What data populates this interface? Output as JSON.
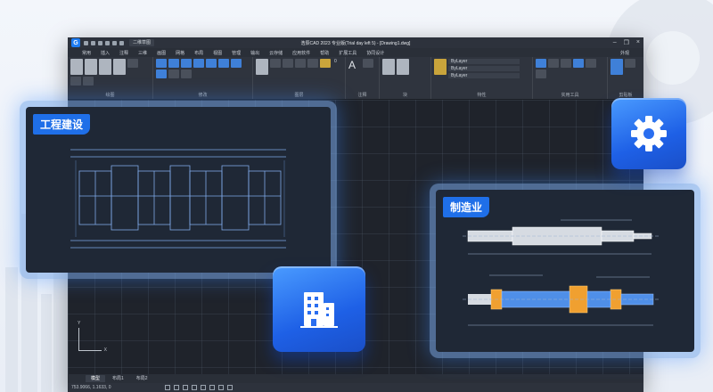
{
  "app": {
    "window_title": "浩辰CAD 2023 专业版(Trial day left 5) - [Drawing1.dwg]",
    "workspace": "二维草图",
    "right_label": "外观"
  },
  "menu": [
    "常用",
    "插入",
    "注释",
    "三维",
    "画图",
    "网格",
    "布局",
    "视图",
    "管理",
    "输出",
    "云存储",
    "应用软件",
    "帮助",
    "扩展工具",
    "协同设计"
  ],
  "ribbon": {
    "draw_tools": [
      "直线",
      "多段线",
      "圆",
      "圆弧"
    ],
    "modify_tools": [
      "移动",
      "复制",
      "拉伸",
      "旋转",
      "镜像",
      "分解",
      "修剪",
      "偏移"
    ],
    "layer_tools": [
      "图层特性"
    ],
    "text_tools": [
      "文字"
    ],
    "insert_tools": [
      "插入",
      "二维码"
    ],
    "property_tools": [
      "特性匹配"
    ],
    "bylayer_values": [
      "ByLayer",
      "ByLayer",
      "ByLayer"
    ],
    "layer_current": "0",
    "group_labels": [
      "绘图",
      "修改",
      "图层",
      "注释",
      "块",
      "特性",
      "实用工具",
      "剪贴板"
    ],
    "other_tools": [
      "组",
      "查询",
      "粘贴"
    ]
  },
  "tabs": [
    "模型",
    "布局1",
    "布局2"
  ],
  "status": {
    "coords": "753.9066, 1.1633, 0"
  },
  "cards": {
    "civil": "工程建设",
    "mfg": "制造业"
  },
  "colors": {
    "accent": "#1f6fe8",
    "canvas": "#1f232b",
    "drawing_blue": "#7fa8e8",
    "drawing_orange": "#f0a030"
  },
  "icons": {
    "settings": "gear-icon",
    "building": "building-icon"
  }
}
